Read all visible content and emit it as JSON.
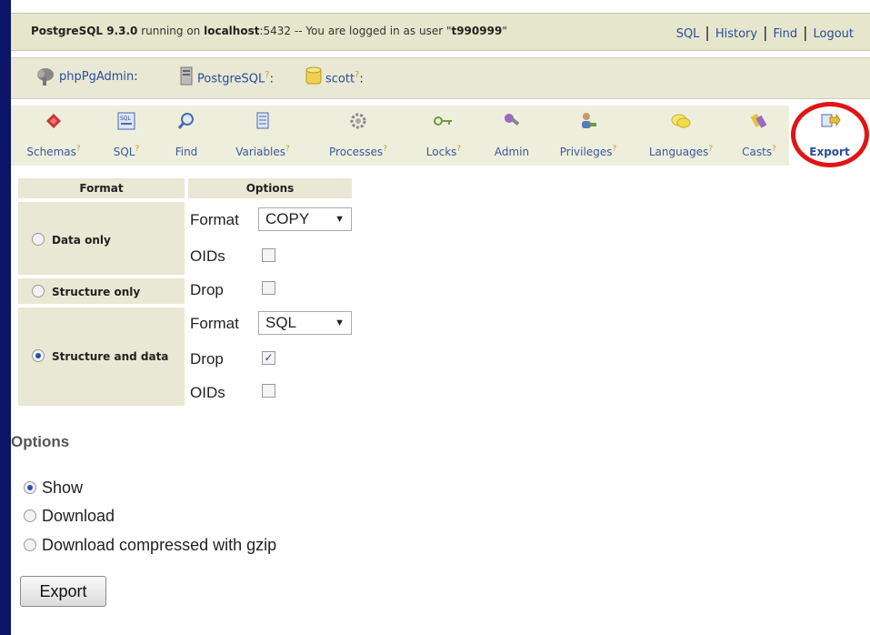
{
  "topbar": {
    "status_prefix": "PostgreSQL 9.3.0",
    "status_running": " running on ",
    "status_host": "localhost",
    "status_rest": ":5432 -- You are logged in as user \"",
    "status_user": "t990999",
    "status_end": "\"",
    "links": [
      "SQL",
      "History",
      "Find",
      "Logout"
    ]
  },
  "breadcrumb": {
    "app": "phpPgAdmin",
    "server": "PostgreSQL",
    "database": "scott",
    "help_mark": "?",
    "colon": ":"
  },
  "tabs": [
    {
      "label": "Schemas",
      "icon": "schemas-icon",
      "help": true
    },
    {
      "label": "SQL",
      "icon": "sql-icon",
      "help": true
    },
    {
      "label": "Find",
      "icon": "find-icon",
      "help": false
    },
    {
      "label": "Variables",
      "icon": "variables-icon",
      "help": true
    },
    {
      "label": "Processes",
      "icon": "processes-icon",
      "help": true
    },
    {
      "label": "Locks",
      "icon": "locks-icon",
      "help": true
    },
    {
      "label": "Admin",
      "icon": "admin-icon",
      "help": false
    },
    {
      "label": "Privileges",
      "icon": "privileges-icon",
      "help": true
    },
    {
      "label": "Languages",
      "icon": "languages-icon",
      "help": true
    },
    {
      "label": "Casts",
      "icon": "casts-icon",
      "help": true
    },
    {
      "label": "Export",
      "icon": "export-icon",
      "help": false,
      "active": true
    }
  ],
  "format_table": {
    "headers": {
      "format": "Format",
      "options": "Options"
    },
    "data_only": "Data only",
    "structure_only": "Structure only",
    "structure_and_data": "Structure and data",
    "format_label": "Format",
    "oids_label": "OIDs",
    "drop_label": "Drop",
    "data_format_value": "COPY",
    "sd_format_value": "SQL",
    "selected": "structure_and_data",
    "sd_drop_checked": true
  },
  "options": {
    "title": "Options",
    "show": "Show",
    "download": "Download",
    "download_gzip": "Download compressed with gzip",
    "selected": "show"
  },
  "export_button": "Export",
  "colors": {
    "accent": "#2b4c9c",
    "frame": "#0b1466",
    "highlight": "#e01515"
  }
}
